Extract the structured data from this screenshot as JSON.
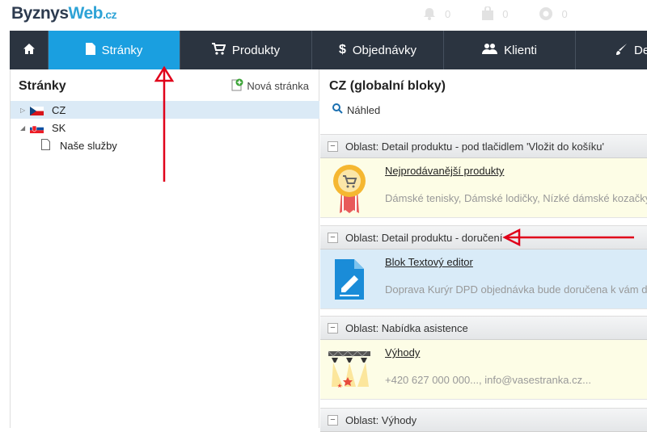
{
  "logo": {
    "part1": "Byznys",
    "part2": "Web",
    "part3": ".cz"
  },
  "notifications": [
    {
      "icon": "bell-icon",
      "count": "0"
    },
    {
      "icon": "bag-icon",
      "count": "0"
    },
    {
      "icon": "lifebuoy-icon",
      "count": "0"
    }
  ],
  "nav": {
    "home_icon": "home-icon",
    "tabs": [
      {
        "label": "Stránky",
        "icon": "file-icon"
      },
      {
        "label": "Produkty",
        "icon": "cart-icon"
      },
      {
        "label": "Objednávky",
        "icon": "dollar-icon"
      },
      {
        "label": "Klienti",
        "icon": "users-icon"
      },
      {
        "label": "De",
        "icon": "brush-icon"
      }
    ]
  },
  "pages": {
    "title": "Stránky",
    "new_page": "Nová stránka",
    "tree": [
      {
        "label": "CZ",
        "flag": "cz",
        "selected": true
      },
      {
        "label": "SK",
        "flag": "sk",
        "selected": false
      },
      {
        "label": "Naše služby",
        "child": true
      }
    ]
  },
  "content": {
    "title": "CZ (globalní bloky)",
    "preview": "Náhled",
    "areas": [
      {
        "label": "Oblast: Detail produktu - pod tlačidlem 'Vložit do košíku'",
        "block": {
          "title": "Nejprodávanější produkty",
          "desc": "Dámské tenisky, Dámské lodičky, Nízké dámské kozačky",
          "icon": "badge-icon",
          "color": "#fdfde6"
        }
      },
      {
        "label": "Oblast: Detail produktu - doručení",
        "block": {
          "title": "Blok Textový editor",
          "desc": "Doprava Kurýr DPD objednávka bude doručena k vám do",
          "icon": "document-edit-icon",
          "color": "#d9ebf8"
        }
      },
      {
        "label": "Oblast: Nabídka asistence",
        "block": {
          "title": "Výhody",
          "desc": "+420 627 000 000..., info@vasestranka.cz...",
          "icon": "spotlight-icon",
          "color": "#fdfde6"
        }
      },
      {
        "label": "Oblast: Výhody"
      }
    ]
  },
  "colors": {
    "accent": "#1a9fe0",
    "nav_bg": "#2b3440",
    "annotation": "#e0001a"
  }
}
